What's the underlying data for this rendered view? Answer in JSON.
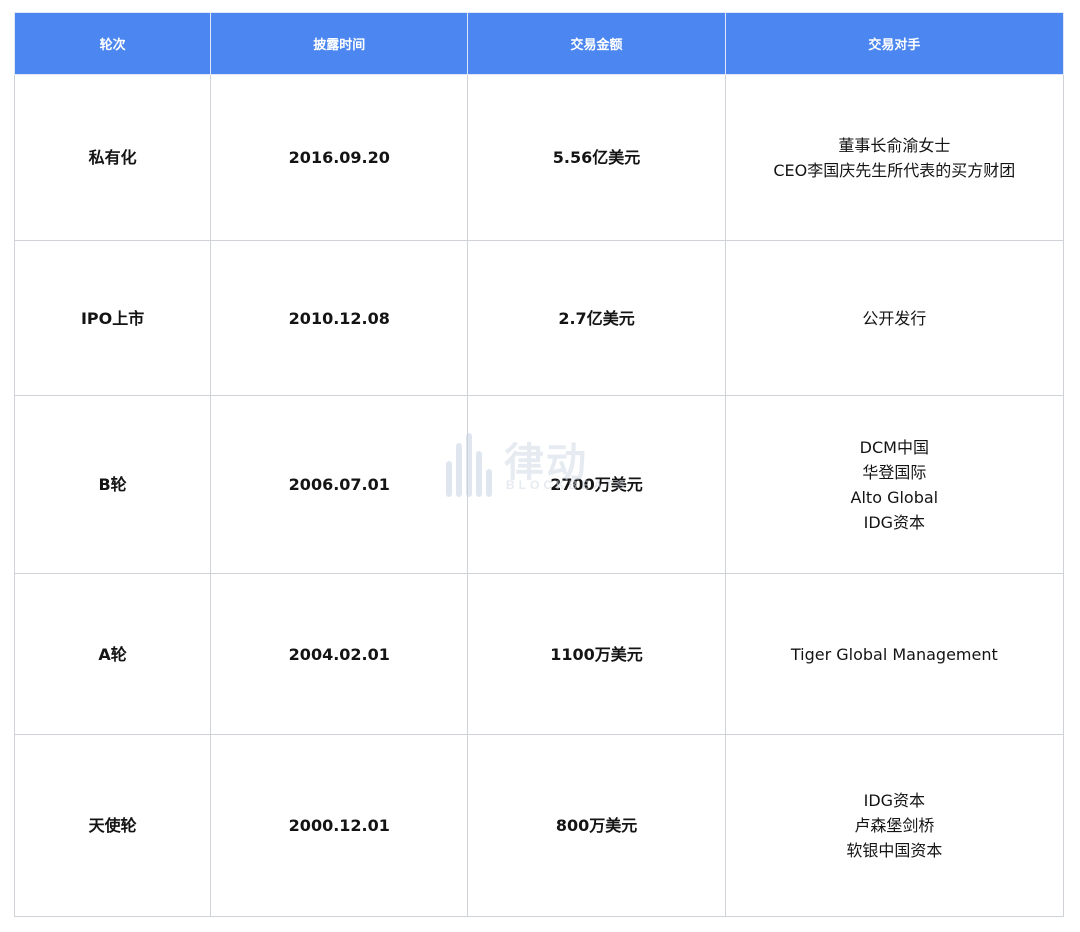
{
  "table": {
    "headers": [
      "轮次",
      "披露时间",
      "交易金额",
      "交易对手"
    ],
    "rows": [
      {
        "round": "私有化",
        "date": "2016.09.20",
        "amount": "5.56亿美元",
        "parties": [
          "董事长俞渝女士",
          "CEO李国庆先生所代表的买方财团"
        ]
      },
      {
        "round": "IPO上市",
        "date": "2010.12.08",
        "amount": "2.7亿美元",
        "parties": [
          "公开发行"
        ]
      },
      {
        "round": "B轮",
        "date": "2006.07.01",
        "amount": "2700万美元",
        "parties": [
          "DCM中国",
          "华登国际",
          "Alto Global",
          "IDG资本"
        ]
      },
      {
        "round": "A轮",
        "date": "2004.02.01",
        "amount": "1100万美元",
        "parties": [
          "Tiger Global Management"
        ]
      },
      {
        "round": "天使轮",
        "date": "2000.12.01",
        "amount": "800万美元",
        "parties": [
          "IDG资本",
          "卢森堡剑桥",
          "软银中国资本"
        ]
      }
    ]
  },
  "watermark": {
    "brand_cn": "律动",
    "brand_en": "BLOCKBEATS"
  },
  "colors": {
    "header_bg": "#4c86f0",
    "header_text": "#ffffff",
    "border": "#cfd3d8"
  }
}
